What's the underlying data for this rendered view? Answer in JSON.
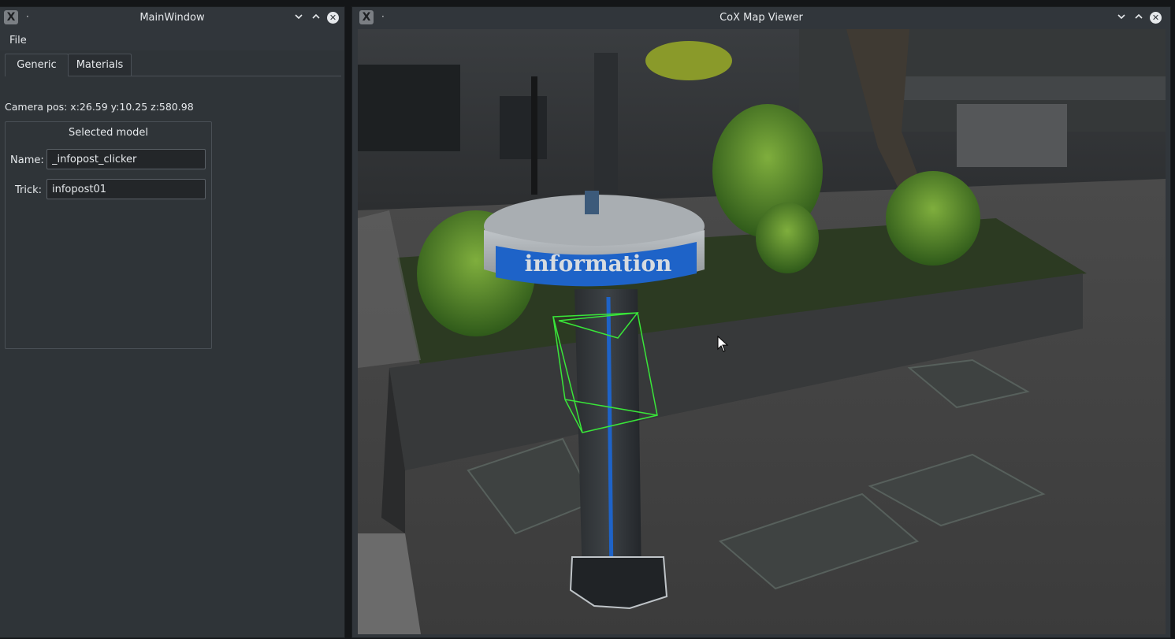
{
  "main_window": {
    "title": "MainWindow",
    "menu": [
      "File"
    ],
    "tabs": [
      {
        "label": "Generic",
        "active": true
      },
      {
        "label": "Materials",
        "active": false
      }
    ],
    "camera_pos": "Camera pos: x:26.59 y:10.25 z:580.98",
    "selected_model": {
      "title": "Selected model",
      "name_label": "Name:",
      "name_value": "_infopost_clicker",
      "trick_label": "Trick:",
      "trick_value": "infopost01"
    }
  },
  "viewer_window": {
    "title": "CoX Map Viewer",
    "scene_text": "information"
  },
  "window_controls": {
    "dot": "·",
    "minimize_icon": "chevron-down-icon",
    "maximize_icon": "chevron-up-icon",
    "close_icon": "close-icon"
  },
  "colors": {
    "selection_box": "#39e639",
    "info_blue": "#1e63c8"
  }
}
